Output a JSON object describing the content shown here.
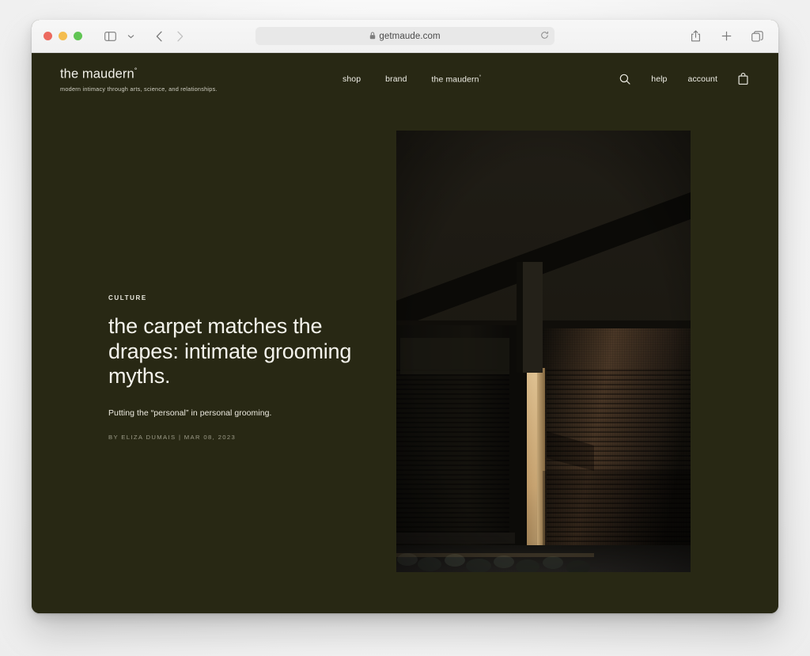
{
  "browser": {
    "url": "getmaude.com",
    "lock_icon": "lock-icon",
    "reload_icon": "reload-icon",
    "privacy_icon": "privacy-reader-icon",
    "sidebar_icon": "sidebar-toggle-icon",
    "sidebar_chevron_icon": "chevron-down-icon",
    "back_icon": "back-arrow-icon",
    "forward_icon": "forward-arrow-icon",
    "share_icon": "share-icon",
    "new_tab_icon": "plus-icon",
    "tabs_icon": "tab-overview-icon",
    "traffic_lights": [
      "close-red",
      "minimize-yellow",
      "maximize-green"
    ]
  },
  "site": {
    "brand": {
      "name": "the maudern",
      "mark": "°",
      "tagline": "modern intimacy through arts, science, and relationships."
    },
    "nav": [
      {
        "label": "shop",
        "mark": ""
      },
      {
        "label": "brand",
        "mark": ""
      },
      {
        "label": "the maudern",
        "mark": "°"
      }
    ],
    "util_nav": {
      "search_icon": "search-icon",
      "help_label": "help",
      "account_label": "account",
      "bag_icon": "shopping-bag-icon"
    }
  },
  "article": {
    "category": "CULTURE",
    "headline": "the carpet matches the drapes: intimate grooming myths.",
    "dek": "Putting the “personal” in personal grooming.",
    "byline": "BY ELIZA DUMAIS | MAR 08, 2023",
    "hero_alt": "dark photograph of window blinds at dusk with warm interior light"
  },
  "colors": {
    "page_background": "#282814",
    "text_primary": "#f4f3ec",
    "text_muted": "#9b9a87",
    "desktop_background": "#f4f4f4"
  }
}
